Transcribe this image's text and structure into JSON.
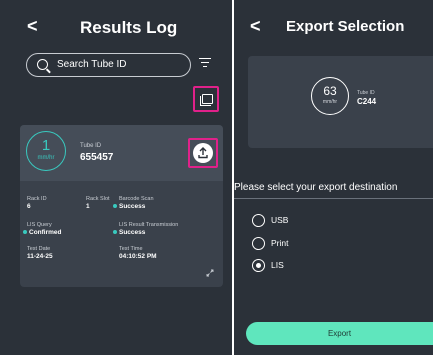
{
  "results_log": {
    "title": "Results Log",
    "back_glyph": "<",
    "search": {
      "placeholder": "Search Tube ID"
    },
    "card": {
      "rate_value": "1",
      "rate_unit": "mm/hr",
      "tube_label": "Tube ID",
      "tube_id": "655457",
      "fields": {
        "rack_id_label": "Rack ID",
        "rack_id_value": "6",
        "rack_slot_label": "Rack Slot",
        "rack_slot_value": "1",
        "barcode_label": "Barcode Scan",
        "barcode_value": "Success",
        "lis_query_label": "LIS Query",
        "lis_query_value": "Confirmed",
        "lis_result_label": "LIS Result Transmission",
        "lis_result_value": "Success",
        "test_date_label": "Test Date",
        "test_date_value": "11-24-25",
        "test_time_label": "Test Time",
        "test_time_value": "04:10:52 PM"
      }
    }
  },
  "export_selection": {
    "title": "Export Selection",
    "back_glyph": "<",
    "rate_value": "63",
    "rate_unit": "mm/hr",
    "tube_label": "Tube ID",
    "tube_id": "C244",
    "prompt": "Please select your export destination",
    "options": [
      {
        "label": "USB",
        "selected": false
      },
      {
        "label": "Print",
        "selected": false
      },
      {
        "label": "LIS",
        "selected": true
      }
    ],
    "export_label": "Export"
  },
  "colors": {
    "background": "#2b3139",
    "card": "#3a414b",
    "accent_teal": "#39c9bf",
    "export_button": "#5fe6bd",
    "highlight_magenta": "#e0218a"
  },
  "icons": [
    "back-chevron-icon",
    "search-icon",
    "filter-icon",
    "gallery-icon",
    "upload-icon",
    "expand-icon"
  ]
}
